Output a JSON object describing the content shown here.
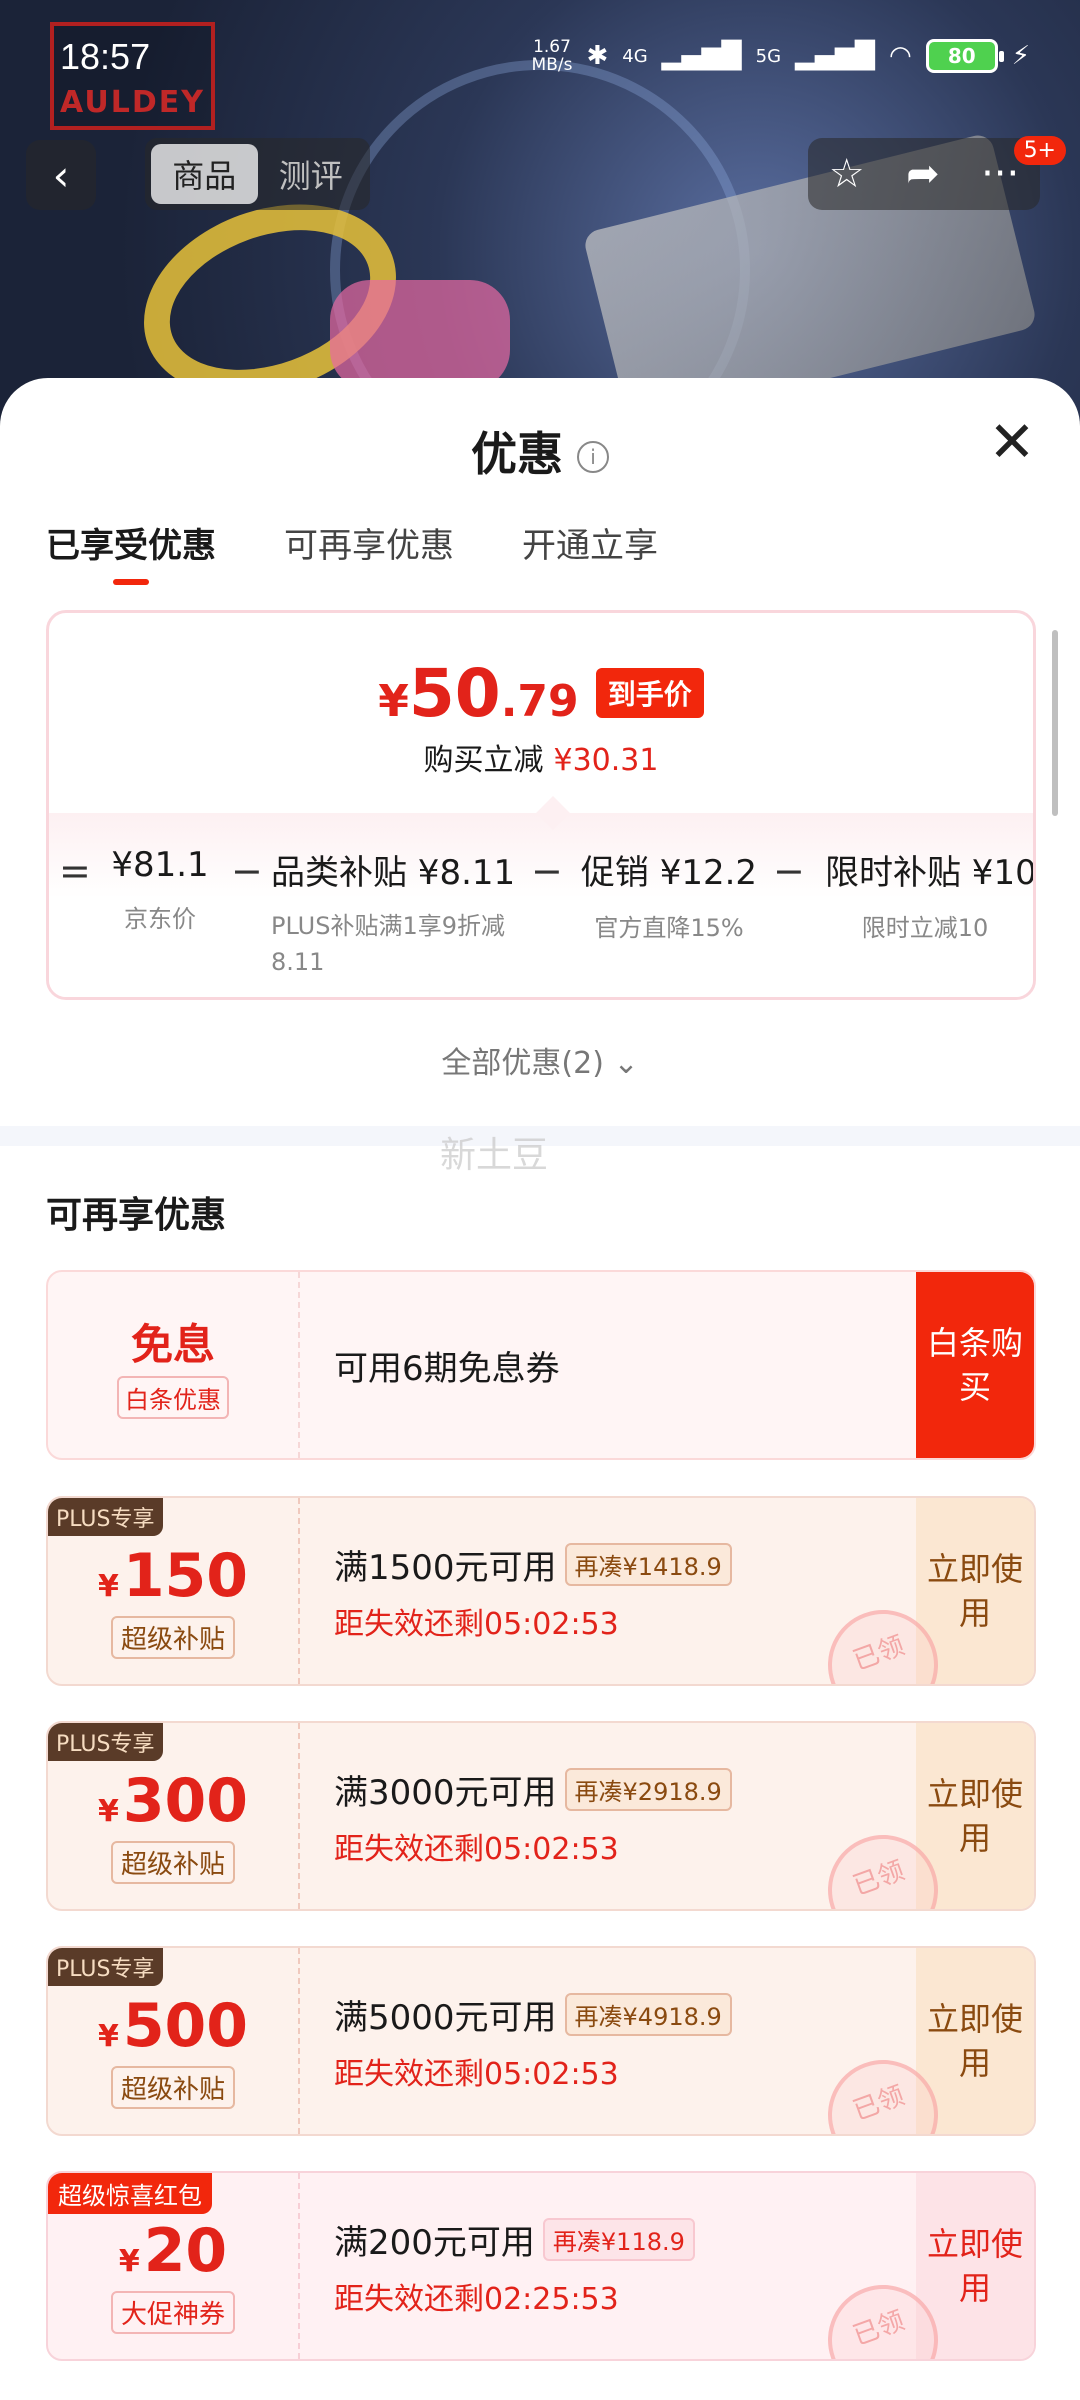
{
  "status_bar": {
    "time": "18:57",
    "speed_value": "1.67",
    "speed_unit": "MB/s",
    "net1": "4G",
    "net2": "5G",
    "battery": "80"
  },
  "background": {
    "brand": "AULDEY"
  },
  "header": {
    "tabs": [
      "商品",
      "测评"
    ],
    "badge": "5+"
  },
  "sheet": {
    "title": "优惠",
    "tabs": [
      "已享受优惠",
      "可再享优惠",
      "开通立享"
    ],
    "price": {
      "currency": "¥",
      "integer": "50",
      "decimal": ".79",
      "tag": "到手价",
      "save_label": "购买立减",
      "save_amount": "¥30.31"
    },
    "breakdown": {
      "ops": [
        "=",
        "−",
        "−",
        "−"
      ],
      "items": [
        {
          "value": "¥81.1",
          "sub": "京东价"
        },
        {
          "value": "品类补贴 ¥8.11",
          "sub": "PLUS补贴满1享9折减8.11"
        },
        {
          "value": "促销 ¥12.2",
          "sub": "官方直降15%"
        },
        {
          "value": "限时补贴 ¥10",
          "sub": "限时立减10"
        }
      ]
    },
    "all_offers": "全部优惠(2)",
    "watermark": "新土豆",
    "section_title": "可再享优惠",
    "baitiao": {
      "big": "免息",
      "tag": "白条优惠",
      "title": "可用6期免息券",
      "action": "白条购买"
    },
    "coupons": [
      {
        "corner": "PLUS专享",
        "currency": "¥",
        "amount": "150",
        "tag": "超级补贴",
        "condition": "满1500元可用",
        "gap": "再凑¥1418.9",
        "expire": "距失效还剩05:02:53",
        "action": "立即使用",
        "stamp": "已领"
      },
      {
        "corner": "PLUS专享",
        "currency": "¥",
        "amount": "300",
        "tag": "超级补贴",
        "condition": "满3000元可用",
        "gap": "再凑¥2918.9",
        "expire": "距失效还剩05:02:53",
        "action": "立即使用",
        "stamp": "已领"
      },
      {
        "corner": "PLUS专享",
        "currency": "¥",
        "amount": "500",
        "tag": "超级补贴",
        "condition": "满5000元可用",
        "gap": "再凑¥4918.9",
        "expire": "距失效还剩05:02:53",
        "action": "立即使用",
        "stamp": "已领"
      },
      {
        "corner": "超级惊喜红包",
        "currency": "¥",
        "amount": "20",
        "tag": "大促神券",
        "condition": "满200元可用",
        "gap": "再凑¥118.9",
        "expire": "距失效还剩02:25:53",
        "action": "立即使用",
        "stamp": "已领"
      }
    ]
  },
  "colors": {
    "accent_red": "#e2231a",
    "plus_dark": "#5a3b28",
    "plus_bg": "#fdf2ec"
  },
  "icons": [
    "bluetooth-icon",
    "signal-icon",
    "wifi-icon",
    "battery-icon",
    "back-icon",
    "star-icon",
    "share-icon",
    "more-icon",
    "info-icon",
    "close-icon",
    "chevron-down-icon"
  ]
}
